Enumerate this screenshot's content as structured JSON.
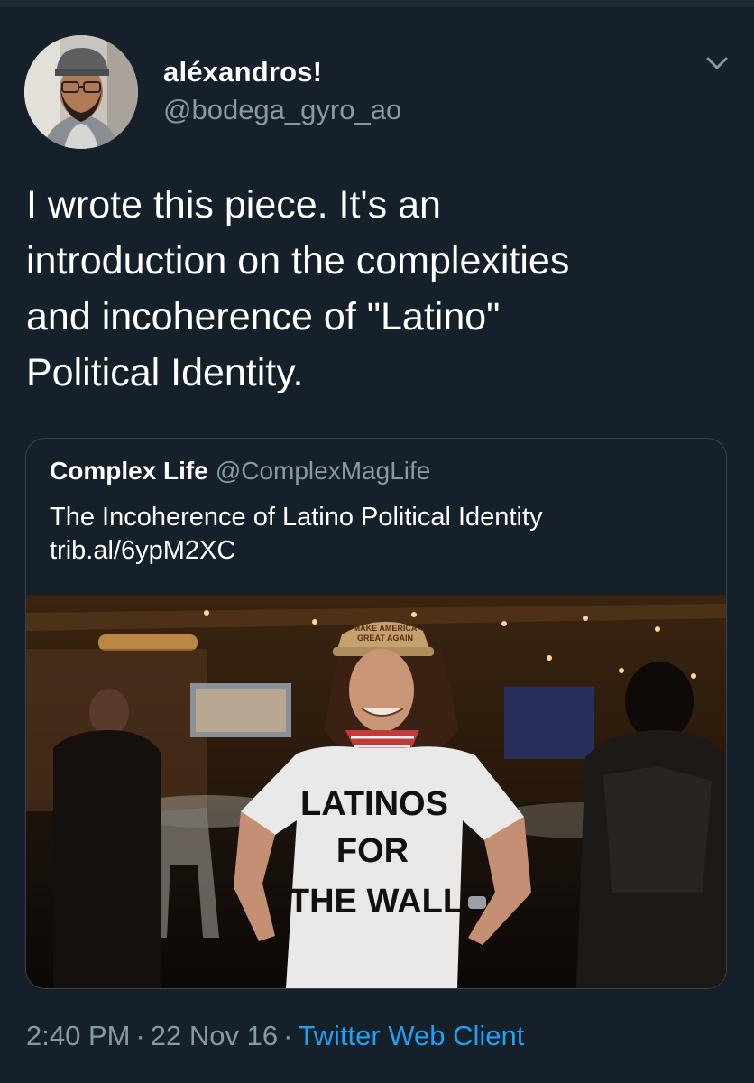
{
  "author": {
    "display_name": "aléxandros!",
    "handle": "@bodega_gyro_ao"
  },
  "tweet": {
    "text": "I wrote this piece. It's an\nintroduction on the complexities\nand incoherence of \"Latino\"\nPolitical Identity."
  },
  "quoted_tweet": {
    "display_name": "Complex Life",
    "handle": "@ComplexMagLife",
    "text": "The Incoherence of Latino Political Identity",
    "link": "trib.al/6ypM2XC",
    "image": {
      "shirt_text": [
        "LATINOS",
        "FOR",
        "THE WALL"
      ],
      "hat_text": [
        "MAKE AMERICA",
        "GREAT AGAIN"
      ]
    }
  },
  "meta": {
    "time": "2:40 PM",
    "date": "22 Nov 16",
    "separator": "·",
    "client": "Twitter Web Client"
  },
  "icons": {
    "menu": "chevron-down-icon"
  },
  "colors": {
    "background": "#15202b",
    "secondary_text": "#8899a6",
    "link": "#1da1f2",
    "border": "#38444d"
  }
}
